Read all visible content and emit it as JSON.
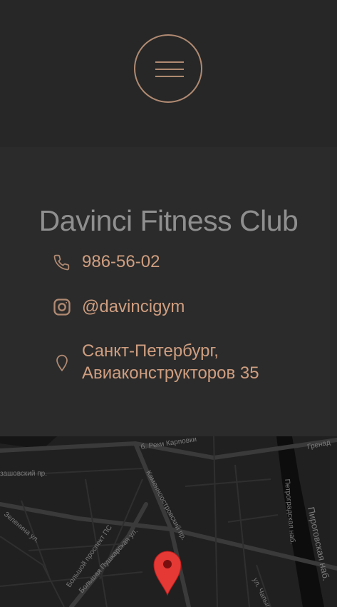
{
  "header": {
    "menu_icon": "hamburger-menu-icon"
  },
  "contact": {
    "title": "Davinci Fitness Club",
    "phone": {
      "icon": "phone-icon",
      "text": "986-56-02"
    },
    "instagram": {
      "icon": "instagram-icon",
      "text": "@davincigym"
    },
    "address": {
      "icon": "map-pin-icon",
      "text": "Санкт-Петербург, Авиаконструкторов 35"
    },
    "colors": {
      "accent": "#cf9e80",
      "title": "#8f8f8f",
      "bg": "#2b2b2b"
    }
  },
  "map": {
    "labels": [
      "б. Реки Карповки",
      "Гренад",
      "зашовский пр.",
      "Каменноостровский пр.",
      "Петроградская наб.",
      "Пироговская наб.",
      "Зеленина ул.",
      "Большой проспект ПС",
      "Большая Пушкарская ул.",
      "ул. Чапыгина"
    ],
    "marker_icon": "map-marker-icon"
  }
}
